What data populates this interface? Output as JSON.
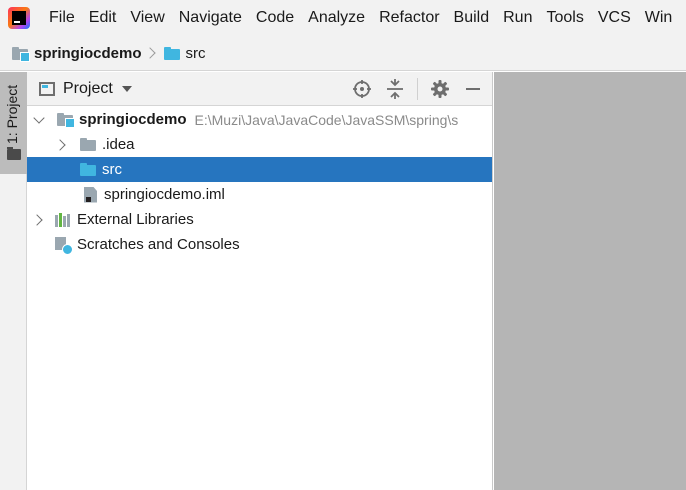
{
  "menu": {
    "items": [
      {
        "label": "File"
      },
      {
        "label": "Edit"
      },
      {
        "label": "View"
      },
      {
        "label": "Navigate"
      },
      {
        "label": "Code"
      },
      {
        "label": "Analyze"
      },
      {
        "label": "Refactor"
      },
      {
        "label": "Build"
      },
      {
        "label": "Run"
      },
      {
        "label": "Tools"
      },
      {
        "label": "VCS"
      },
      {
        "label": "Win"
      }
    ]
  },
  "breadcrumb": {
    "project": "springiocdemo",
    "folder": "src"
  },
  "toolstrip": {
    "project_tab": "1: Project"
  },
  "panel": {
    "title": "Project"
  },
  "tree": {
    "root": {
      "label": "springiocdemo",
      "path": "E:\\Muzi\\Java\\JavaCode\\JavaSSM\\spring\\s"
    },
    "idea": ".idea",
    "src": "src",
    "iml": "springiocdemo.iml",
    "libraries": "External Libraries",
    "scratches": "Scratches and Consoles"
  },
  "colors": {
    "selection": "#2675bf",
    "folder_blue": "#40b6e0",
    "editor_bg": "#b5b5b5",
    "chrome_bg": "#f2f2f2"
  }
}
